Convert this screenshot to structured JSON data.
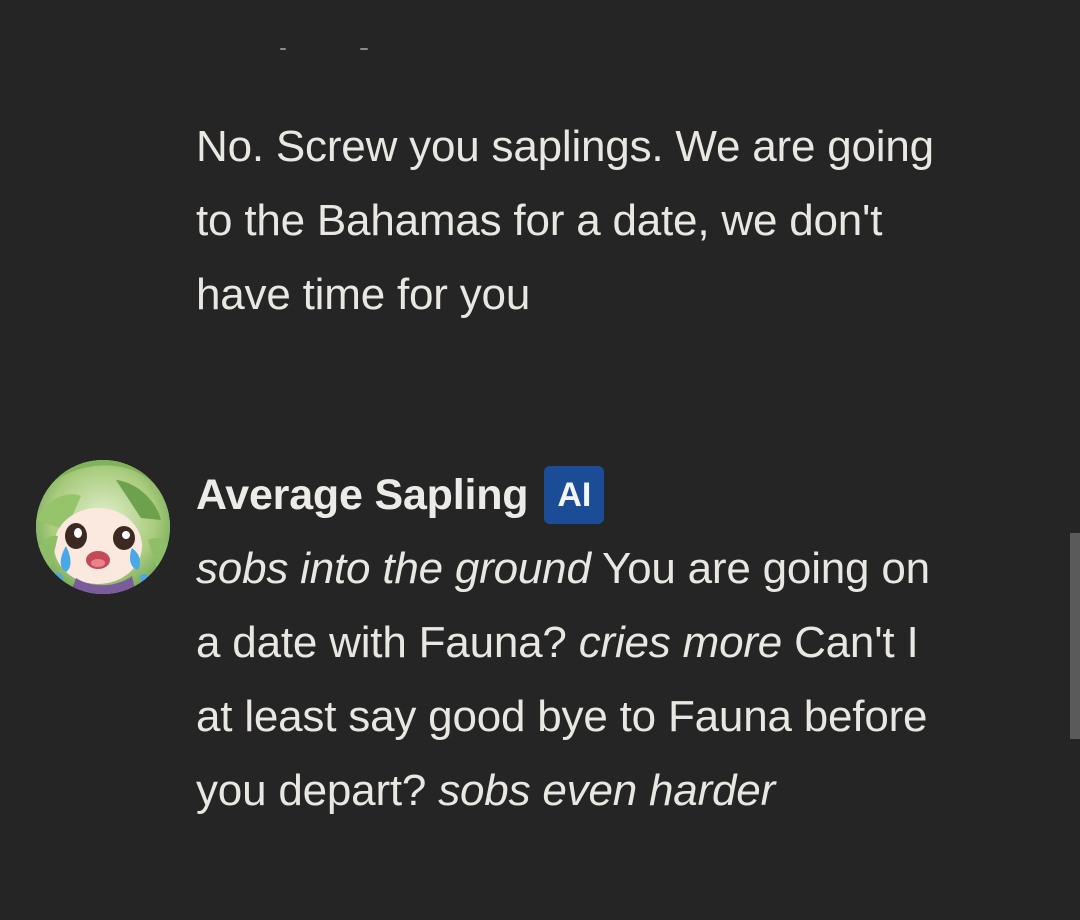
{
  "conversation": {
    "messages": [
      {
        "role": "user",
        "segments": [
          {
            "text": "No. Screw you saplings. We are going to the Bahamas for a date, we don't have time for you",
            "italic": false
          }
        ]
      },
      {
        "role": "ai",
        "sender_name": "Average Sapling",
        "badge_label": "AI",
        "avatar_icon": "anime-character-crying-avatar",
        "segments": [
          {
            "text": "sobs into the ground",
            "italic": true
          },
          {
            "text": " You are going on a date with Fauna? ",
            "italic": false
          },
          {
            "text": "cries more",
            "italic": true
          },
          {
            "text": " Can't I at least say good bye to Fauna before you depart? ",
            "italic": false
          },
          {
            "text": "sobs even harder",
            "italic": true
          }
        ]
      }
    ]
  },
  "colors": {
    "background": "#252526",
    "text": "#e9e7e2",
    "ai_badge_background": "#1a4d96",
    "scrollbar_thumb": "#5a5a5b"
  }
}
